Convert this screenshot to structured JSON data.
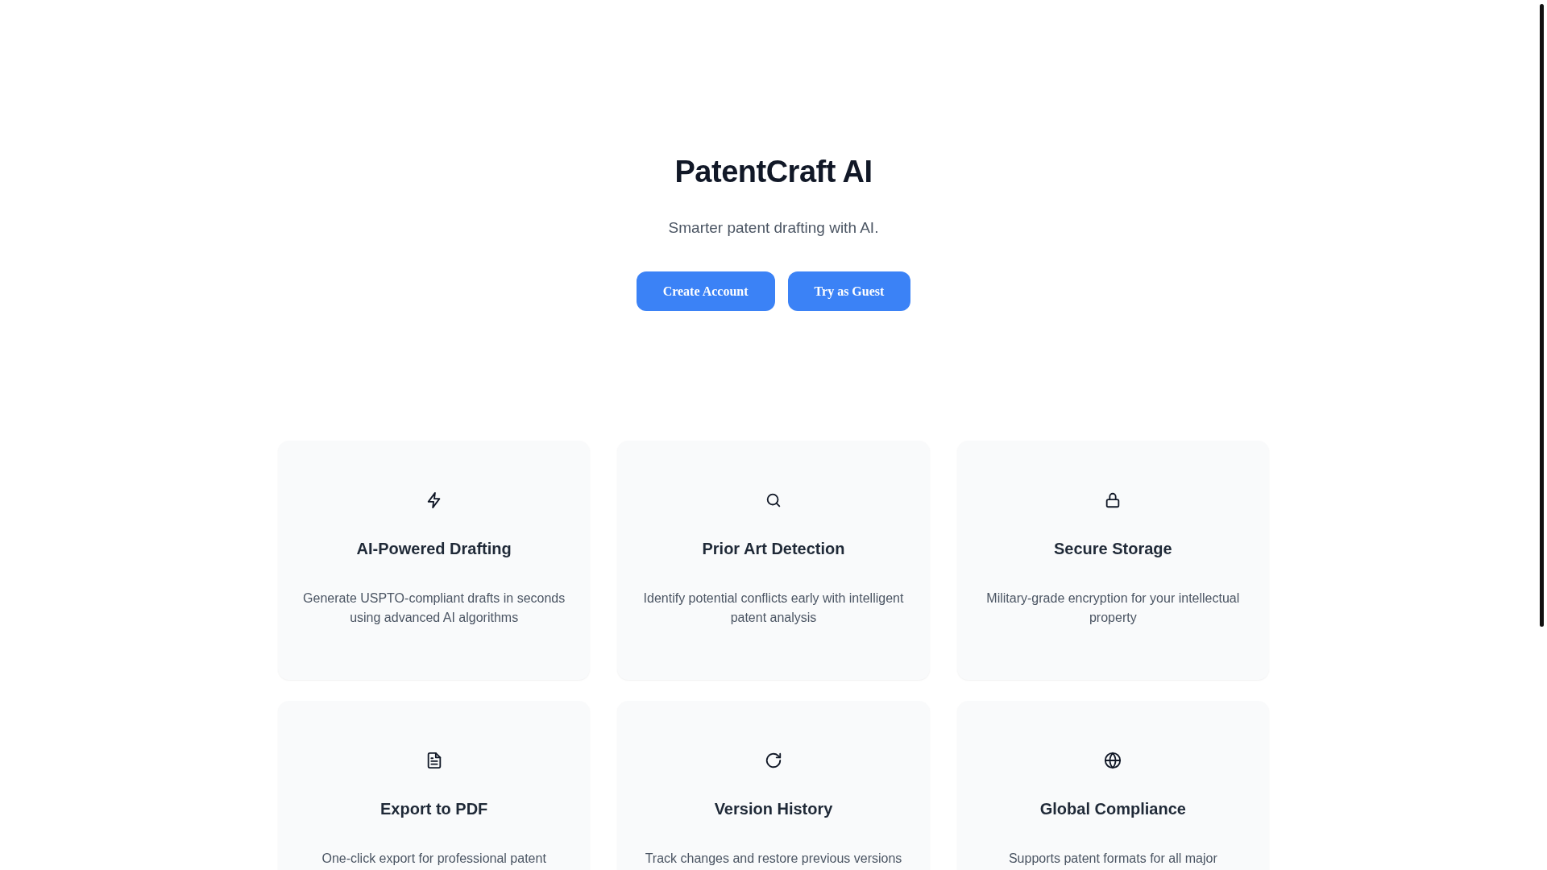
{
  "hero": {
    "title": "PatentCraft AI",
    "subtitle": "Smarter patent drafting with AI.",
    "buttons": [
      {
        "label": "Create Account",
        "kind": "primary"
      },
      {
        "label": "Try as Guest",
        "kind": "primary"
      }
    ]
  },
  "features": [
    {
      "kind": "bolt",
      "title": "AI-Powered Drafting",
      "description": "Generate USPTO-compliant drafts in seconds using advanced AI algorithms"
    },
    {
      "kind": "search",
      "title": "Prior Art Detection",
      "description": "Identify potential conflicts early with intelligent patent analysis"
    },
    {
      "kind": "lock",
      "title": "Secure Storage",
      "description": "Military-grade encryption for your intellectual property"
    },
    {
      "kind": "document",
      "title": "Export to PDF",
      "description": "One-click export for professional patent"
    },
    {
      "kind": "refresh",
      "title": "Version History",
      "description": "Track changes and restore previous versions"
    },
    {
      "kind": "globe",
      "title": "Global Compliance",
      "description": "Supports patent formats for all major"
    }
  ]
}
